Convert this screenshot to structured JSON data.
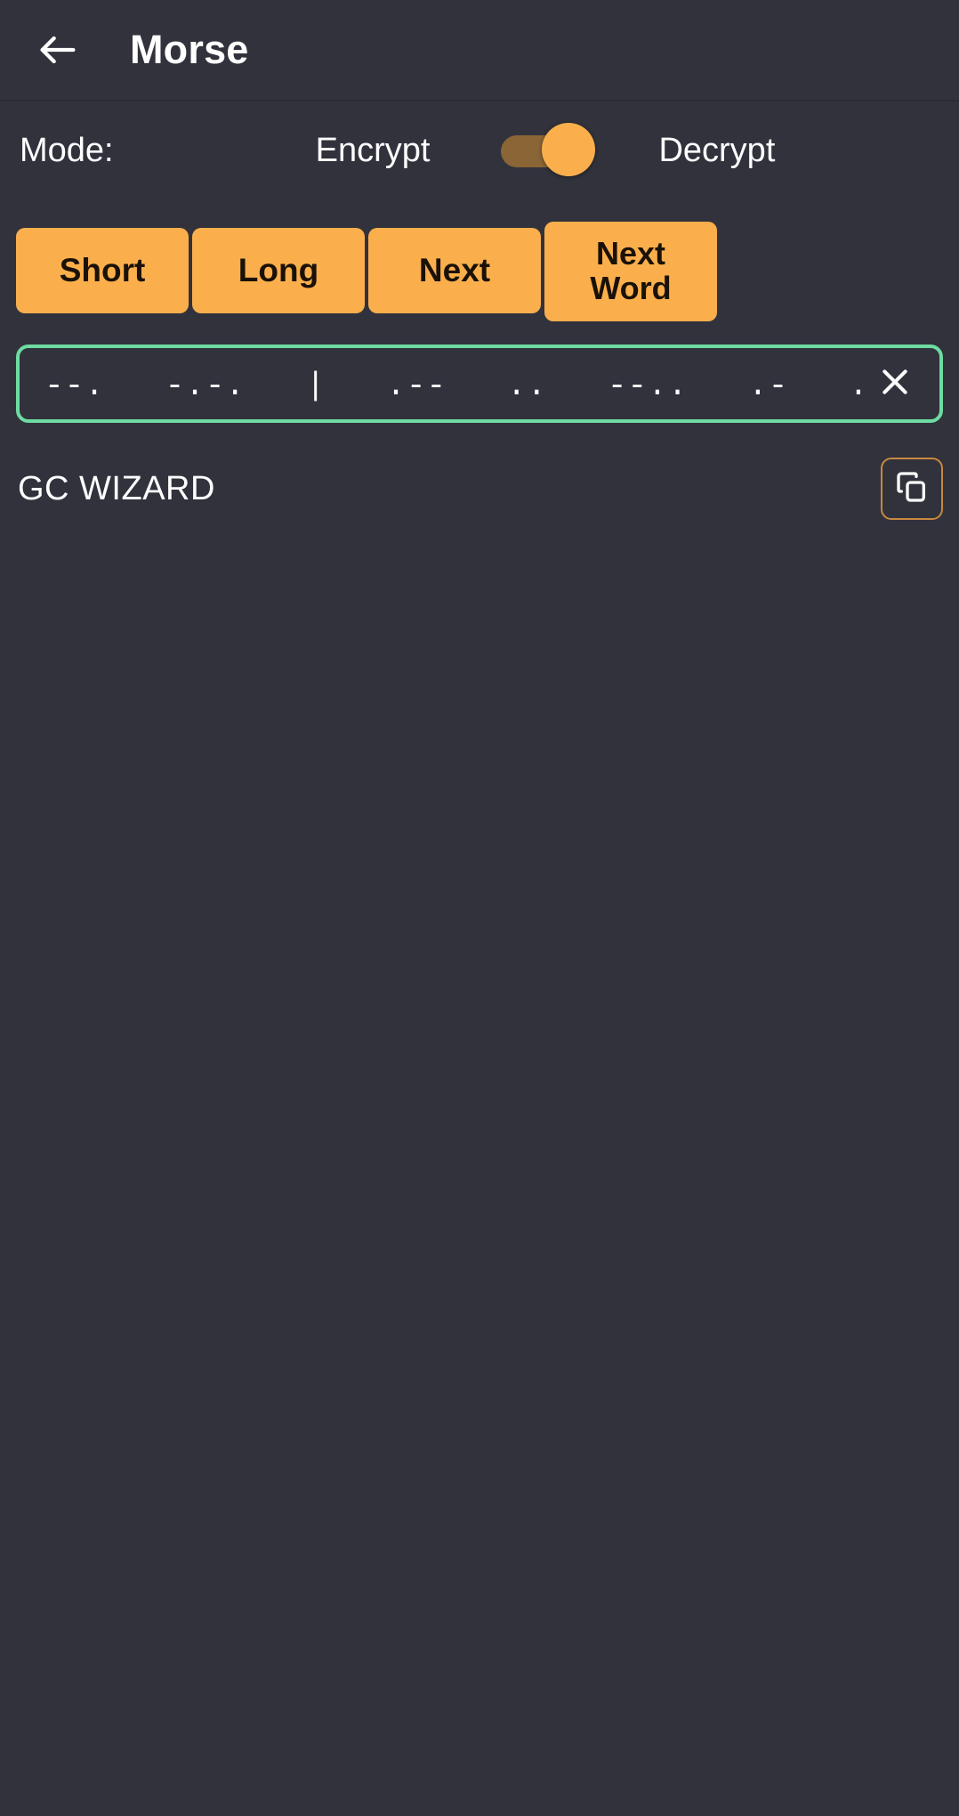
{
  "appbar": {
    "back_icon": "arrow-left-icon",
    "title": "Morse"
  },
  "mode": {
    "label": "Mode:",
    "option_left": "Encrypt",
    "option_right": "Decrypt",
    "toggle_state": "decrypt",
    "toggle_on": true
  },
  "actions": {
    "short": "Short",
    "long": "Long",
    "next": "Next",
    "next_word": "Next\nWord"
  },
  "input": {
    "value": "--.   -.-.   |   .--   ..   --..   .-   .-.   -..",
    "placeholder": "",
    "clear_icon": "close-icon",
    "caret_visible": true,
    "focused": true
  },
  "output": {
    "value": "GC WIZARD",
    "copy_icon": "copy-icon"
  },
  "colors": {
    "background": "#31323c",
    "accent": "#fbaf4c",
    "focus_border": "#6edba2",
    "caret": "#4c7fe0",
    "copy_border": "#c9883f",
    "switch_track": "#8a6536",
    "divider": "#2b2c35",
    "text": "#ffffff",
    "button_text": "#1a1208"
  }
}
